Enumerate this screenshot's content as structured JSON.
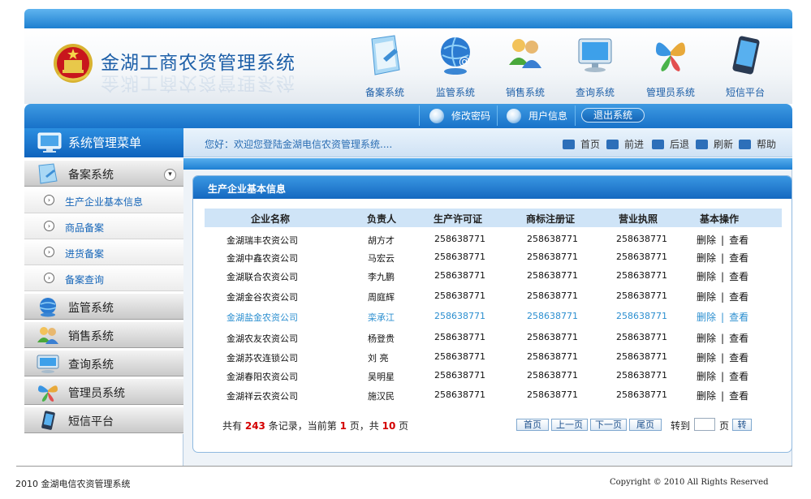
{
  "header": {
    "title": "金湖工商农资管理系统",
    "systems": [
      {
        "label": "备案系统",
        "icon": "filing-icon"
      },
      {
        "label": "监管系统",
        "icon": "globe-mail-icon"
      },
      {
        "label": "销售系统",
        "icon": "users-icon"
      },
      {
        "label": "查询系统",
        "icon": "monitor-icon"
      },
      {
        "label": "管理员系统",
        "icon": "admin-butterfly-icon"
      },
      {
        "label": "短信平台",
        "icon": "phone-icon"
      }
    ]
  },
  "toolbar": {
    "change_password": "修改密码",
    "user_info": "用户信息",
    "logout": "退出系统"
  },
  "sidebar": {
    "header": "系统管理菜单",
    "sections": [
      {
        "label": "备案系统",
        "expanded": true,
        "icon": "filing-icon",
        "items": [
          "生产企业基本信息",
          "商品备案",
          "进货备案",
          "备案查询"
        ]
      },
      {
        "label": "监管系统",
        "icon": "globe-icon"
      },
      {
        "label": "销售系统",
        "icon": "users-icon"
      },
      {
        "label": "查询系统",
        "icon": "monitor-icon"
      },
      {
        "label": "管理员系统",
        "icon": "admin-icon"
      },
      {
        "label": "短信平台",
        "icon": "phone-icon"
      }
    ]
  },
  "welcome": "您好：欢迎您登陆金湖电信农资管理系统....",
  "nav": {
    "home": "首页",
    "forward": "前进",
    "back": "后退",
    "refresh": "刷新",
    "help": "帮助"
  },
  "panel": {
    "title": "生产企业基本信息",
    "columns": [
      "企业名称",
      "负责人",
      "生产许可证",
      "商标注册证",
      "营业执照",
      "基本操作"
    ],
    "rows": [
      {
        "name": "金湖瑞丰农资公司",
        "person": "胡方才",
        "license": "258638771",
        "trademark": "258638771",
        "business": "258638771"
      },
      {
        "name": "金湖中鑫农资公司",
        "person": "马宏云",
        "license": "258638771",
        "trademark": "258638771",
        "business": "258638771"
      },
      {
        "name": "金湖联合农资公司",
        "person": "李九鹏",
        "license": "258638771",
        "trademark": "258638771",
        "business": "258638771"
      },
      {
        "name": "金湖金谷农资公司",
        "person": "周庭辉",
        "license": "258638771",
        "trademark": "258638771",
        "business": "258638771"
      },
      {
        "name": "金湖盐金农资公司",
        "person": "栾承江",
        "license": "258638771",
        "trademark": "258638771",
        "business": "258638771",
        "highlighted": true
      },
      {
        "name": "金湖农友农资公司",
        "person": "杨登贵",
        "license": "258638771",
        "trademark": "258638771",
        "business": "258638771"
      },
      {
        "name": "金湖苏农连锁公司",
        "person": "刘 亮",
        "license": "258638771",
        "trademark": "258638771",
        "business": "258638771"
      },
      {
        "name": "金湖春阳农资公司",
        "person": "吴明星",
        "license": "258638771",
        "trademark": "258638771",
        "business": "258638771"
      },
      {
        "name": "金湖祥云农资公司",
        "person": "施汉民",
        "license": "258638771",
        "trademark": "258638771",
        "business": "258638771"
      }
    ],
    "ops": {
      "delete": "删除",
      "sep": "|",
      "view": "查看"
    }
  },
  "pagination": {
    "prefix": "共有",
    "total": "243",
    "mid": "条记录，当前第",
    "current": "1",
    "mid2": "页，共",
    "pages": "10",
    "suffix": "页",
    "first": "首页",
    "prev": "上一页",
    "next": "下一页",
    "last": "尾页",
    "goto": "转到",
    "goto_value": "",
    "page_unit": "页",
    "go": "转"
  },
  "footer": {
    "left": "2010 金湖电信农资管理系统",
    "right": "Copyright © 2010  All Rights Reserved"
  },
  "colors": {
    "primary": "#1d7fd0",
    "title": "#1d5fa8",
    "link": "#1565b8",
    "highlight": "#2c8fd0",
    "count": "#d40000"
  }
}
